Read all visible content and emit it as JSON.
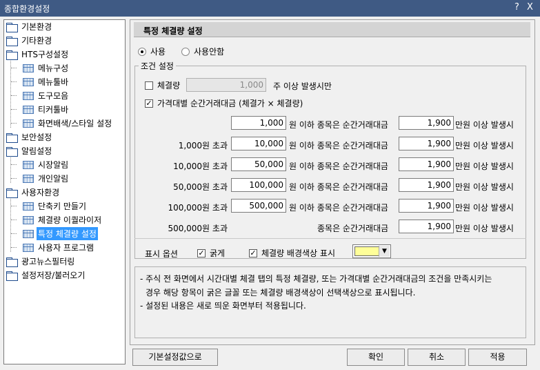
{
  "window": {
    "title": "종합환경설정",
    "help_label": "?",
    "close_label": "X"
  },
  "tree": {
    "items": [
      {
        "label": "기본환경"
      },
      {
        "label": "기타환경"
      },
      {
        "label": "HTS구성설정"
      },
      {
        "label": "메뉴구성"
      },
      {
        "label": "메뉴툴바"
      },
      {
        "label": "도구모음"
      },
      {
        "label": "티커툴바"
      },
      {
        "label": "화면배색/스타일 설정"
      },
      {
        "label": "보안설정"
      },
      {
        "label": "알림설정"
      },
      {
        "label": "시장알림"
      },
      {
        "label": "개인알림"
      },
      {
        "label": "사용자환경"
      },
      {
        "label": "단축키 만들기"
      },
      {
        "label": "체결량 이퀄라이저"
      },
      {
        "label": "특정 체결량 설정"
      },
      {
        "label": "사용자 프로그램"
      },
      {
        "label": "광고뉴스필터링"
      },
      {
        "label": "설정저장/불러오기"
      }
    ]
  },
  "panel": {
    "header": "특정 체결량 설정",
    "radio_use": "사용",
    "radio_nouse": "사용안함",
    "condition_group": "조건 설정",
    "volume_check_label": "체결량",
    "volume_value": "1,000",
    "volume_suffix": "주 이상 발생시만",
    "price_check_mark": "✓",
    "price_check_label": "가격대별 순간거래대금 (체결가 × 체결량)",
    "rows": [
      {
        "prefix": "",
        "price": "1,000",
        "mid": "원 이하 종목은 순간거래대금",
        "amount": "1,900",
        "suffix": "만원 이상 발생시"
      },
      {
        "prefix": "1,000원 초과",
        "price": "10,000",
        "mid": "원 이하 종목은 순간거래대금",
        "amount": "1,900",
        "suffix": "만원 이상 발생시"
      },
      {
        "prefix": "10,000원 초과",
        "price": "50,000",
        "mid": "원 이하 종목은 순간거래대금",
        "amount": "1,900",
        "suffix": "만원 이상 발생시"
      },
      {
        "prefix": "50,000원 초과",
        "price": "100,000",
        "mid": "원 이하 종목은 순간거래대금",
        "amount": "1,900",
        "suffix": "만원 이상 발생시"
      },
      {
        "prefix": "100,000원 초과",
        "price": "500,000",
        "mid": "원 이하 종목은 순간거래대금",
        "amount": "1,900",
        "suffix": "만원 이상 발생시"
      },
      {
        "prefix": "500,000원 초과",
        "price": "",
        "mid": "종목은 순간거래대금",
        "amount": "1,900",
        "suffix": "만원 이상 발생시"
      }
    ],
    "display_options_label": "표시 옵션",
    "bold_mark": "✓",
    "bold_label": "굵게",
    "bg_mark": "✓",
    "bg_label": "체결량 배경색상 표시",
    "bg_color": "#ffff99",
    "dropdown_arrow": "▼",
    "notes": [
      "- 주식 전 화면에서 시간대별 체결 탭의 특정 체결량, 또는 가격대별 순간거래대금의 조건을 만족시키는",
      "경우 해당 항목이 굵은 글꼴 또는 체결량 배경색상이 선택색상으로 표시됩니다.",
      "- 설정된 내용은 새로 띄운 화면부터 적용됩니다."
    ]
  },
  "buttons": {
    "default": "기본설정값으로",
    "ok": "확인",
    "cancel": "취소",
    "apply": "적용"
  }
}
